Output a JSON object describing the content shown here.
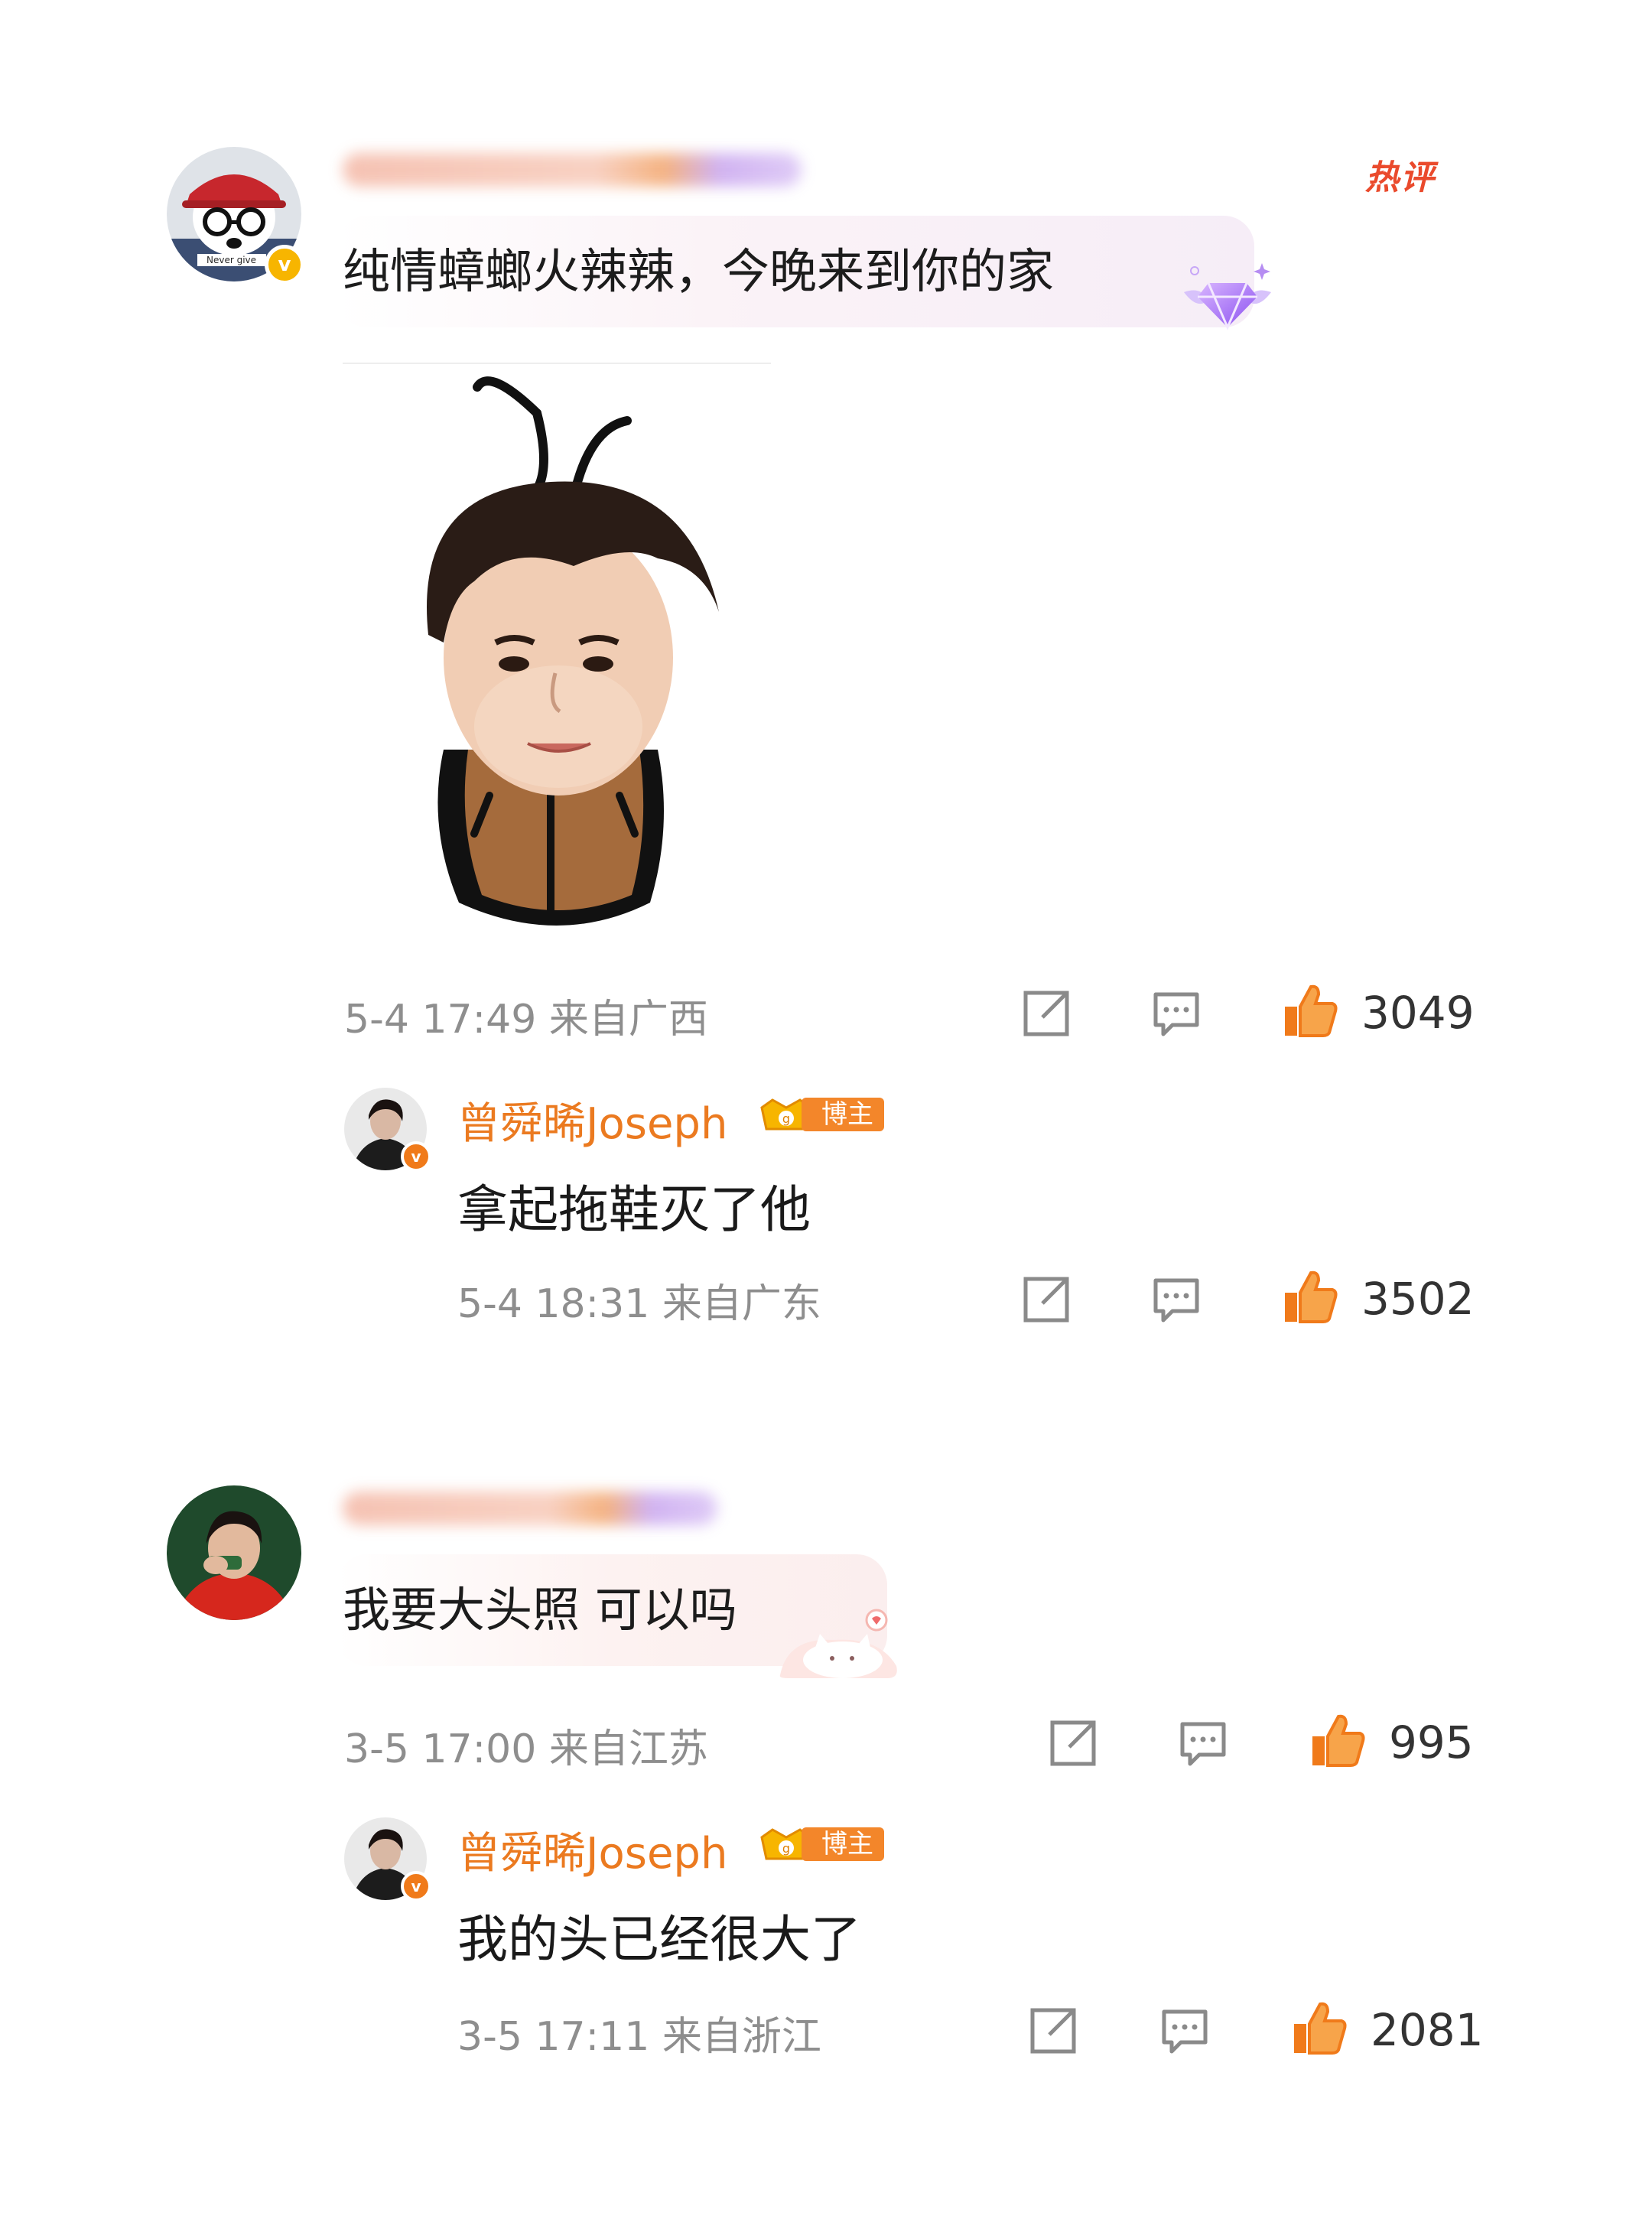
{
  "comments": [
    {
      "hot_tag": "热评",
      "text": "纯情蟑螂火辣辣，今晚来到你的家",
      "avatar_caption": "Never give",
      "meta": "5-4 17:49 来自广西",
      "likes": "3049",
      "reply": {
        "username": "曾舜晞Joseph",
        "badge": "博主",
        "text": "拿起拖鞋灭了他",
        "meta": "5-4 18:31 来自广东",
        "likes": "3502"
      }
    },
    {
      "text": "我要大头照 可以吗",
      "meta": "3-5 17:00 来自江苏",
      "likes": "995",
      "reply": {
        "username": "曾舜晞Joseph",
        "badge": "博主",
        "text": "我的头已经很大了",
        "meta": "3-5 17:11 来自浙江",
        "likes": "2081"
      }
    }
  ],
  "icons": {
    "share": "share-icon",
    "comment": "comment-icon",
    "like": "thumbs-up-icon",
    "verified": "verified-v-icon",
    "gem": "diamond-gem-icon"
  },
  "colors": {
    "like_orange": "#f07a1a",
    "username_orange": "#eb7a20",
    "hot_red": "#ea4a2c",
    "meta_gray": "#8e8e8e"
  }
}
